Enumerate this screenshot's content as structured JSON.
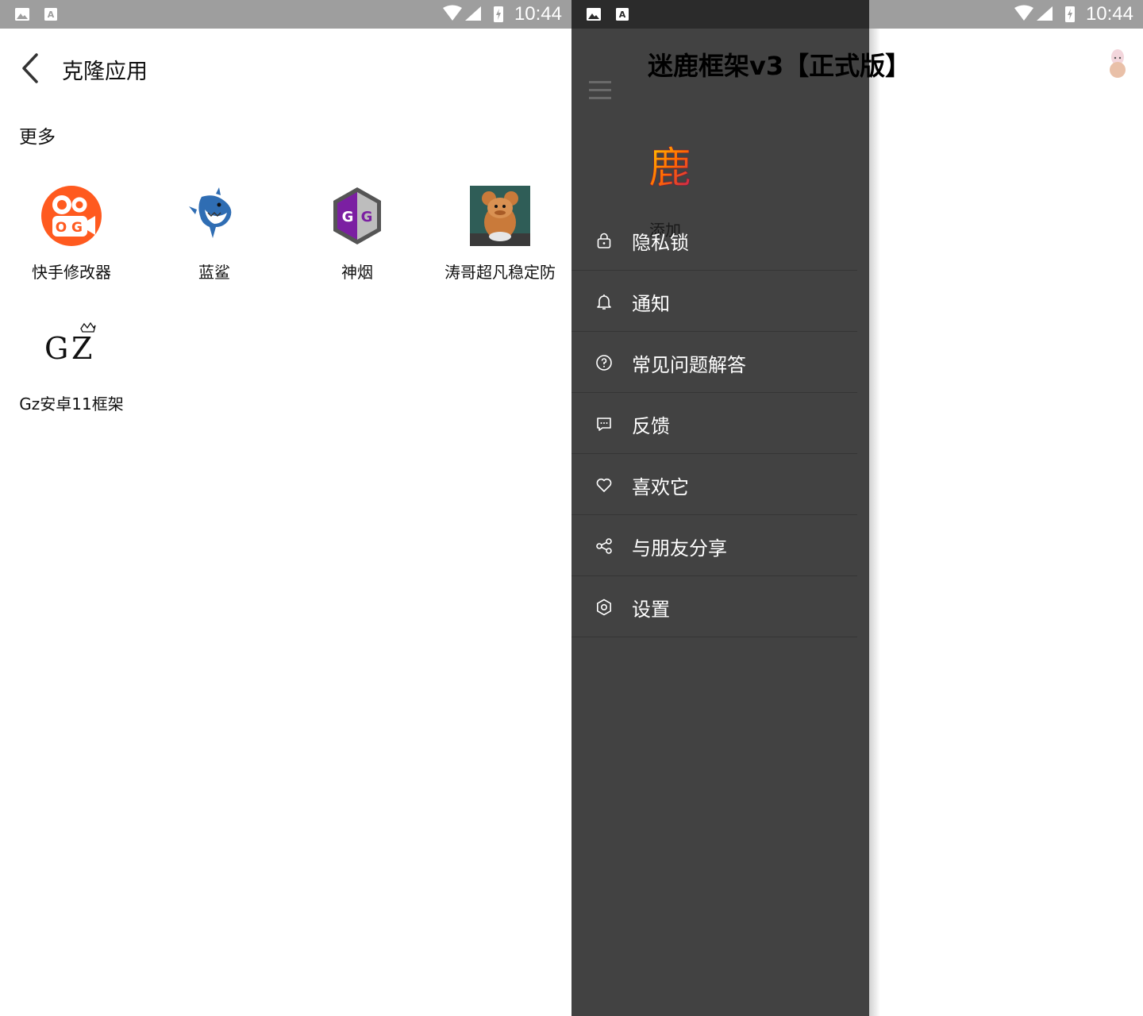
{
  "status_bar": {
    "time": "10:44"
  },
  "clone_page": {
    "title": "克隆应用",
    "section_title": "更多",
    "apps": [
      {
        "label": "快手修改器",
        "icon": "kuaishou-icon"
      },
      {
        "label": "蓝鲨",
        "icon": "shark-icon"
      },
      {
        "label": "神烟",
        "icon": "gameguardian-icon"
      },
      {
        "label": "涛哥超凡稳定防",
        "icon": "jerry-icon"
      },
      {
        "label": "Gz安卓11框架",
        "icon": "gz-logo-icon"
      }
    ]
  },
  "main_page": {
    "title": "迷鹿框架v3【正式版】",
    "drawer": {
      "logo_text": "鹿",
      "add_label": "添加",
      "items": [
        {
          "label": "隐私锁",
          "icon": "lock-icon"
        },
        {
          "label": "通知",
          "icon": "bell-icon"
        },
        {
          "label": "常见问题解答",
          "icon": "help-icon"
        },
        {
          "label": "反馈",
          "icon": "feedback-icon"
        },
        {
          "label": "喜欢它",
          "icon": "heart-icon"
        },
        {
          "label": "与朋友分享",
          "icon": "share-icon"
        },
        {
          "label": "设置",
          "icon": "gear-icon"
        }
      ]
    }
  },
  "colors": {
    "drawer_bg": "#424242",
    "statusbar_grey": "#9e9e9e",
    "kuaishou_orange": "#ff5a1f",
    "gg_purple": "#7b1fa2"
  }
}
